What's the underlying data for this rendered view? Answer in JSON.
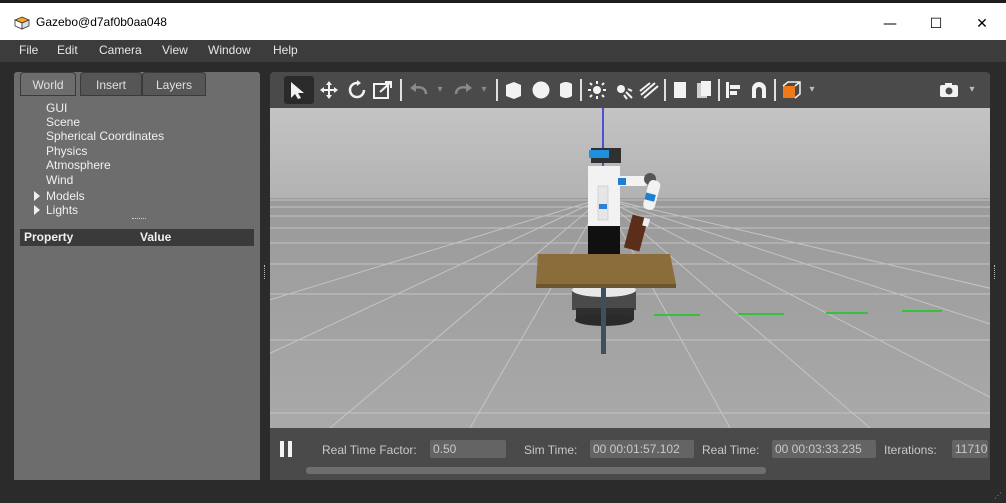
{
  "window": {
    "title": "Gazebo@d7af0b0aa048",
    "minimize": "—",
    "maximize": "☐",
    "close": "✕"
  },
  "menu": {
    "items": [
      "File",
      "Edit",
      "Camera",
      "View",
      "Window",
      "Help"
    ]
  },
  "left_panel": {
    "tabs": [
      "World",
      "Insert",
      "Layers"
    ],
    "active_tab": "World",
    "tree": [
      "GUI",
      "Scene",
      "Spherical Coordinates",
      "Physics",
      "Atmosphere",
      "Wind",
      "Models",
      "Lights"
    ],
    "property_header": {
      "property": "Property",
      "value": "Value"
    }
  },
  "toolbar": {
    "icons": [
      "select-arrow-icon",
      "translate-icon",
      "rotate-icon",
      "scale-icon",
      "undo-icon",
      "undo-dropdown-icon",
      "redo-icon",
      "redo-dropdown-icon",
      "box-icon",
      "sphere-icon",
      "cylinder-icon",
      "point-light-icon",
      "spot-light-icon",
      "directional-light-icon",
      "copy-icon",
      "paste-icon",
      "align-icon",
      "snap-icon",
      "view-angle-icon",
      "screenshot-icon"
    ],
    "active_tool": "select-arrow-icon"
  },
  "status": {
    "real_time_factor_label": "Real Time Factor:",
    "real_time_factor": "0.50",
    "sim_time_label": "Sim Time:",
    "sim_time": "00 00:01:57.102",
    "real_time_label": "Real Time:",
    "real_time": "00 00:03:33.235",
    "iterations_label": "Iterations:",
    "iterations": "11710"
  },
  "colors": {
    "background": "#2b2b2b",
    "panel": "#6d6d6d",
    "toolbar": "#4a4a4a",
    "sky": "#b5b5b5",
    "ground": "#9e9e9e",
    "accent_orange": "#f07a1a"
  }
}
